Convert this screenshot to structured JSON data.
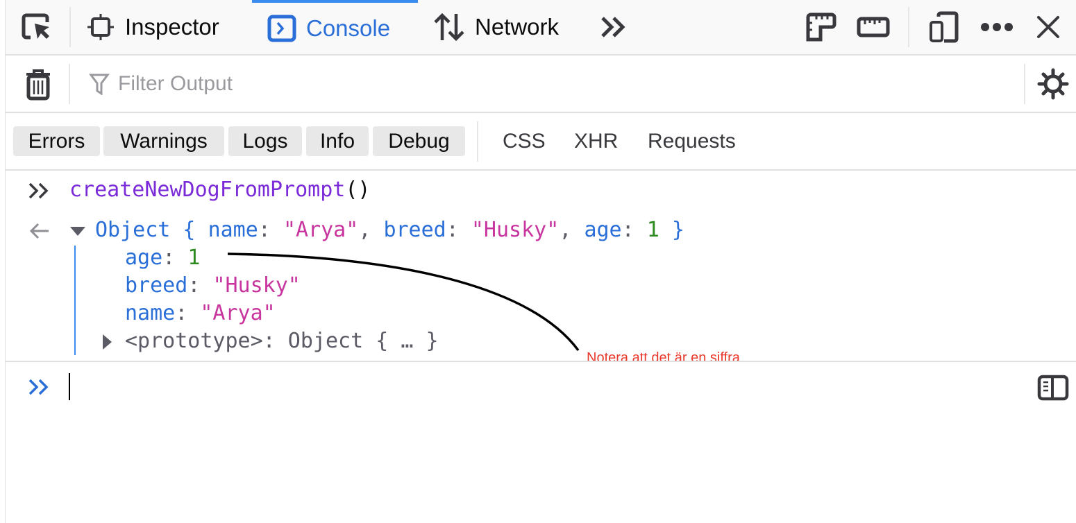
{
  "toolbar": {
    "tabs": [
      {
        "label": "Inspector"
      },
      {
        "label": "Console"
      },
      {
        "label": "Network"
      }
    ]
  },
  "filter": {
    "placeholder": "Filter Output"
  },
  "levels": [
    {
      "label": "Errors"
    },
    {
      "label": "Warnings"
    },
    {
      "label": "Logs"
    },
    {
      "label": "Info"
    },
    {
      "label": "Debug"
    }
  ],
  "types": [
    {
      "label": "CSS"
    },
    {
      "label": "XHR"
    },
    {
      "label": "Requests"
    }
  ],
  "console": {
    "input": "createNewDogFromPrompt",
    "input_parens": "()",
    "summary": {
      "prefix": "Object { ",
      "k1": "name",
      "v1": "\"Arya\"",
      "k2": "breed",
      "v2": "\"Husky\"",
      "k3": "age",
      "v3": "1",
      "suffix": " }"
    },
    "props": [
      {
        "key": "age",
        "value": "1",
        "type": "number"
      },
      {
        "key": "breed",
        "value": "\"Husky\"",
        "type": "string"
      },
      {
        "key": "name",
        "value": "\"Arya\"",
        "type": "string"
      }
    ],
    "prototype": "<prototype>: Object { … }"
  },
  "annotation": {
    "text": "Notera att det är en siffra",
    "color": "#e8382b"
  },
  "colors": {
    "accent": "#2a6fd8"
  }
}
